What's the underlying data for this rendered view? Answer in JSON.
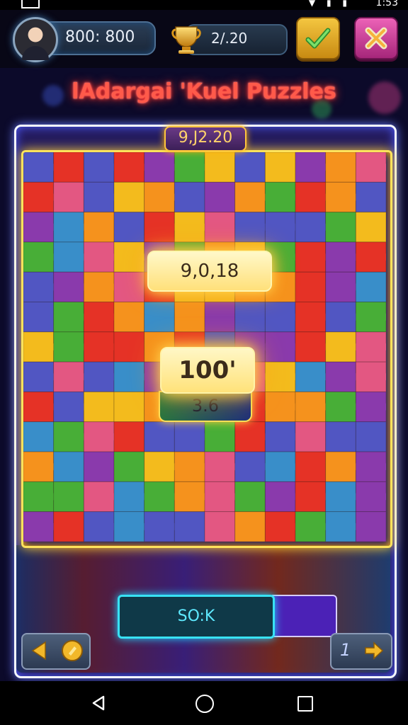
{
  "status_bar": {
    "time": "1:53"
  },
  "header": {
    "score_display": "800: 800",
    "trophy_display": "2/.20"
  },
  "title": "lAdargai 'Kuel Puzzles",
  "board": {
    "top_badge": "9,J2.20",
    "card_top": "9,0,18",
    "card_middle": "100'",
    "card_bottom": "3.6"
  },
  "bottom": {
    "input_text": "SO:K",
    "right_number": "1"
  },
  "colors": {
    "title_glow": "#ff3b2b",
    "board_border": "#ffe35c",
    "frame_border": "#f4f8ff",
    "input_border": "#38e2f4",
    "check_button": "#f4c640",
    "close_button": "#ec62b7"
  },
  "icons": {
    "avatar": "avatar",
    "trophy": "trophy-icon",
    "check": "check-icon",
    "close": "close-icon",
    "left_arrow": "arrow-left-icon",
    "right_arrow": "arrow-right-icon",
    "coin": "coin-icon",
    "back": "nav-back-icon",
    "home": "nav-home-icon",
    "recent": "nav-recent-icon"
  }
}
